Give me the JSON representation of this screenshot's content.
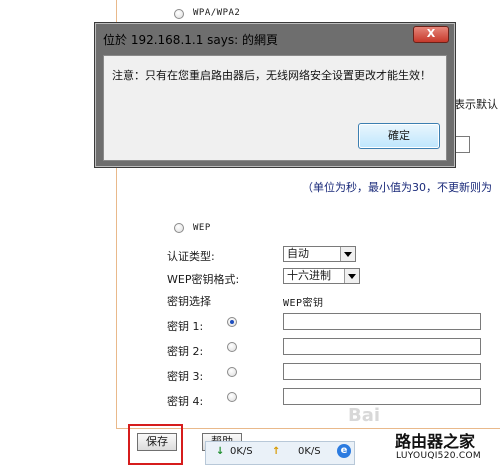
{
  "top": {
    "wpa_label": "WPA/WPA2",
    "right_partial": "表示默认",
    "interval_note": "（单位为秒，最小值为30，不更新则为"
  },
  "wep": {
    "label": "WEP",
    "auth_type_label": "认证类型:",
    "auth_type_value": "自动",
    "key_format_label": "WEP密钥格式:",
    "key_format_value": "十六进制",
    "key_select_label": "密钥选择",
    "wep_key_header": "WEP密钥",
    "keys": [
      {
        "label": "密钥 1:"
      },
      {
        "label": "密钥 2:"
      },
      {
        "label": "密钥 3:"
      },
      {
        "label": "密钥 4:"
      }
    ],
    "selected_key": 1
  },
  "buttons": {
    "save_label": "保存",
    "help_label": "帮助"
  },
  "dialog": {
    "title": "位於 192.168.1.1 says: 的網頁",
    "close_label": "X",
    "message": "注意：只有在您重启路由器后，无线网络安全设置更改才能生效！",
    "ok_label": "確定"
  },
  "status_strip": {
    "down_speed": "0K/S",
    "up_speed": "0K/S"
  },
  "watermark": {
    "brand": "路由器之家",
    "url": "LUYOUQI520.COM"
  },
  "colors": {
    "save_highlight": "#d61c1c",
    "page_border": "#e9b98b",
    "radio_selected": "#1f4fbf"
  }
}
